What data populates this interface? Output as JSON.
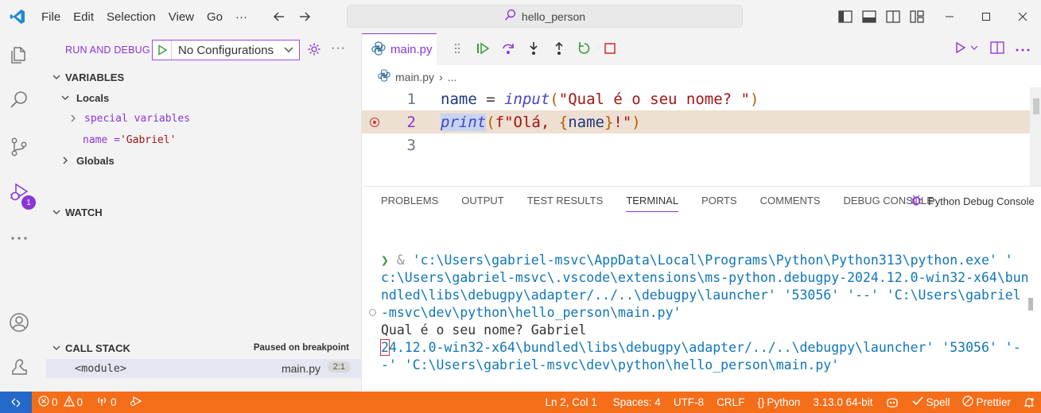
{
  "titlebar": {
    "menu": [
      "File",
      "Edit",
      "Selection",
      "View",
      "Go",
      "···"
    ],
    "search": "hello_person"
  },
  "activity": {
    "debug_badge": "1"
  },
  "sidebar": {
    "title": "RUN AND DEBUG",
    "config": "No Configurations",
    "variables": {
      "header": "VARIABLES",
      "locals": "Locals",
      "special": "special variables",
      "name_var": "name = ",
      "name_val": "'Gabriel'",
      "globals": "Globals"
    },
    "watch": "WATCH",
    "callstack": {
      "header": "CALL STACK",
      "status": "Paused on breakpoint",
      "frame": "<module>",
      "file": "main.py",
      "position": "2:1"
    }
  },
  "editor": {
    "tab": "main.py",
    "breadcrumb": [
      "main.py",
      "..."
    ],
    "lines": [
      {
        "n": "1",
        "tokens": [
          [
            "name",
            "tok-var"
          ],
          [
            " = ",
            "tok-op"
          ],
          [
            "input",
            "tok-fn"
          ],
          [
            "(",
            "tok-par"
          ],
          [
            "\"Qual é o seu nome? \"",
            "tok-str"
          ],
          [
            ")",
            "tok-par"
          ]
        ]
      },
      {
        "n": "2",
        "tokens": [
          [
            "print",
            "tok-fn hl-print"
          ],
          [
            "(",
            "tok-par"
          ],
          [
            "f\"Olá, ",
            "tok-str"
          ],
          [
            "{",
            "tok-brace"
          ],
          [
            "name",
            "tok-var"
          ],
          [
            "}",
            "tok-brace"
          ],
          [
            "!\"",
            "tok-str"
          ],
          [
            ")",
            "tok-par"
          ]
        ]
      },
      {
        "n": "3",
        "tokens": []
      }
    ]
  },
  "panel": {
    "tabs": [
      "PROBLEMS",
      "OUTPUT",
      "TEST RESULTS",
      "TERMINAL",
      "PORTS",
      "COMMENTS",
      "DEBUG CONSOLE"
    ],
    "active_tab": "TERMINAL",
    "console_name": "Python Debug Console",
    "terminal": {
      "prompt": "❯",
      "amp": " & ",
      "cmd_lines": [
        "'c:\\Users\\gabriel-msvc\\AppData\\Local\\Programs\\Python\\Python313\\python.exe' '",
        "c:\\Users\\gabriel-msvc\\.vscode\\extensions\\ms-python.debugpy-2024.12.0-win32-x64\\bun",
        "ndled\\libs\\debugpy\\adapter/../..\\debugpy\\launcher' '53056' '--' 'C:\\Users\\gabriel",
        "-msvc\\dev\\python\\hello_person\\main.py'"
      ],
      "input_line": "Qual é o seu nome? Gabriel",
      "echo_first": "2",
      "echo_rest": "4.12.0-win32-x64\\bundled\\libs\\debugpy\\adapter/../..\\debugpy\\launcher' '53056' '-",
      "echo_line2": "-' 'C:\\Users\\gabriel-msvc\\dev\\python\\hello_person\\main.py'"
    }
  },
  "statusbar": {
    "errors": "0",
    "warnings": "0",
    "ports": "0",
    "position": "Ln 2, Col 1",
    "spaces": "Spaces: 4",
    "encoding": "UTF-8",
    "eol": "CRLF",
    "language": "Python",
    "interpreter": "3.13.0 64-bit",
    "spell": "Spell",
    "prettier": "Prettier"
  }
}
